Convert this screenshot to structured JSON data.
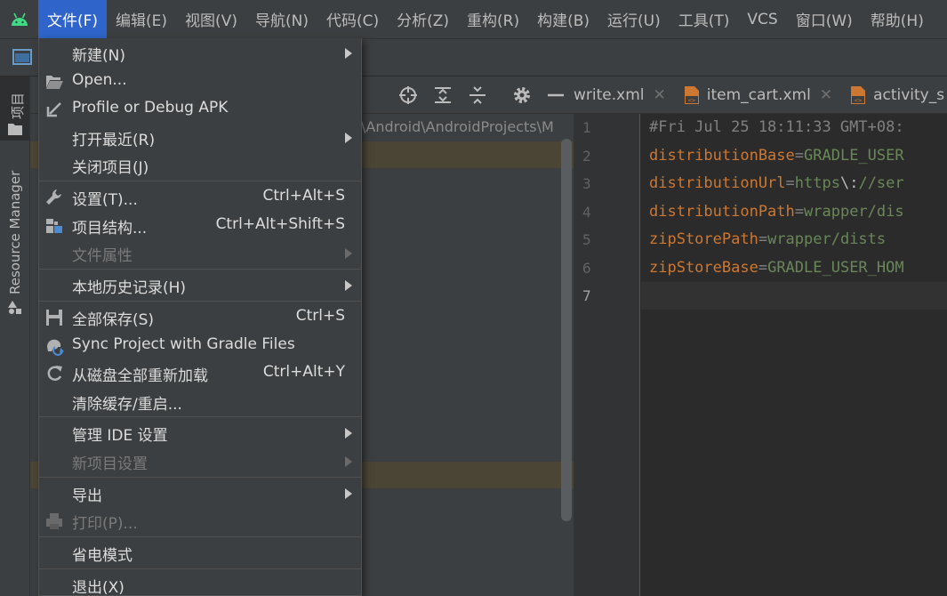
{
  "menubar": {
    "items": [
      "文件(F)",
      "编辑(E)",
      "视图(V)",
      "导航(N)",
      "代码(C)",
      "分析(Z)",
      "重构(R)",
      "构建(B)",
      "运行(U)",
      "工具(T)",
      "VCS",
      "窗口(W)",
      "帮助(H)"
    ],
    "active_index": 0
  },
  "left_strip": {
    "project_tab": "项目",
    "resource_manager_tab": "Resource Manager"
  },
  "project_panel": {
    "path": "\\Android\\AndroidProjects\\M"
  },
  "editor": {
    "tabs": [
      {
        "label": "write.xml"
      },
      {
        "label": "item_cart.xml"
      },
      {
        "label": "activity_s"
      }
    ],
    "line_numbers": [
      "1",
      "2",
      "3",
      "4",
      "5",
      "6",
      "7"
    ],
    "current_line": 7,
    "lines": [
      {
        "comment": "#Fri Jul 25 18:11:33 GMT+08:"
      },
      {
        "key": "distributionBase",
        "eq": "=",
        "value": "GRADLE_USER"
      },
      {
        "key": "distributionUrl",
        "eq": "=",
        "value": "https",
        "esc": "\\:",
        "value2": "//ser"
      },
      {
        "key": "distributionPath",
        "eq": "=",
        "value": "wrapper/dis"
      },
      {
        "key": "zipStorePath",
        "eq": "=",
        "value": "wrapper/dists"
      },
      {
        "key": "zipStoreBase",
        "eq": "=",
        "value": "GRADLE_USER_HOM"
      }
    ]
  },
  "file_menu": {
    "items": [
      {
        "label": "新建(N)",
        "shortcut": "",
        "submenu": true,
        "disabled": false,
        "icon": "none"
      },
      {
        "label": "Open...",
        "shortcut": "",
        "submenu": false,
        "disabled": false,
        "icon": "folder-open-icon"
      },
      {
        "label": "Profile or Debug APK",
        "shortcut": "",
        "submenu": false,
        "disabled": false,
        "icon": "import-arrow-icon"
      },
      {
        "label": "打开最近(R)",
        "shortcut": "",
        "submenu": true,
        "disabled": false,
        "icon": "none"
      },
      {
        "label": "关闭项目(J)",
        "shortcut": "",
        "submenu": false,
        "disabled": false,
        "icon": "none"
      },
      {
        "label": "设置(T)...",
        "shortcut": "Ctrl+Alt+S",
        "submenu": false,
        "disabled": false,
        "icon": "wrench-icon"
      },
      {
        "label": "项目结构...",
        "shortcut": "Ctrl+Alt+Shift+S",
        "submenu": false,
        "disabled": false,
        "icon": "project-structure-icon"
      },
      {
        "label": "文件属性",
        "shortcut": "",
        "submenu": true,
        "disabled": true,
        "icon": "none"
      },
      {
        "label": "本地历史记录(H)",
        "shortcut": "",
        "submenu": true,
        "disabled": false,
        "icon": "none"
      },
      {
        "label": "全部保存(S)",
        "shortcut": "Ctrl+S",
        "submenu": false,
        "disabled": false,
        "icon": "save-icon"
      },
      {
        "label": "Sync Project with Gradle Files",
        "shortcut": "",
        "submenu": false,
        "disabled": false,
        "icon": "gradle-sync-icon"
      },
      {
        "label": "从磁盘全部重新加载",
        "shortcut": "Ctrl+Alt+Y",
        "submenu": false,
        "disabled": false,
        "icon": "reload-icon"
      },
      {
        "label": "清除缓存/重启...",
        "shortcut": "",
        "submenu": false,
        "disabled": false,
        "icon": "none"
      },
      {
        "label": "管理 IDE 设置",
        "shortcut": "",
        "submenu": true,
        "disabled": false,
        "icon": "none"
      },
      {
        "label": "新项目设置",
        "shortcut": "",
        "submenu": true,
        "disabled": true,
        "icon": "none"
      },
      {
        "label": "导出",
        "shortcut": "",
        "submenu": true,
        "disabled": false,
        "icon": "none"
      },
      {
        "label": "打印(P)...",
        "shortcut": "",
        "submenu": false,
        "disabled": true,
        "icon": "printer-icon"
      },
      {
        "label": "省电模式",
        "shortcut": "",
        "submenu": false,
        "disabled": false,
        "icon": "none"
      },
      {
        "label": "退出(X)",
        "shortcut": "",
        "submenu": false,
        "disabled": false,
        "icon": "none"
      }
    ]
  },
  "colors": {
    "menu_highlight": "#2f65ca",
    "android_green": "#3ddc84",
    "key_orange": "#cc7832",
    "value_green": "#6a8759",
    "comment_gray": "#808080"
  }
}
